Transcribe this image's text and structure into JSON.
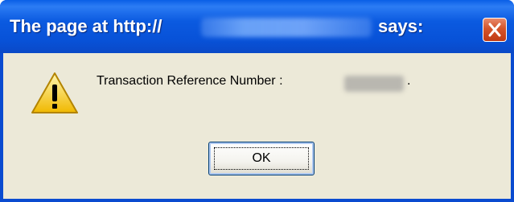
{
  "dialog": {
    "title_prefix": "The page at http://",
    "title_url": "",
    "title_suffix": "says:",
    "close_icon": "close-icon",
    "message_label": "Transaction Reference Number :",
    "message_value": "",
    "message_end": ".",
    "icon": "warning-icon",
    "ok_label": "OK"
  },
  "colors": {
    "titlebar": "#0a5fe6",
    "client": "#ece9d8",
    "close": "#d4542a",
    "warning": "#f5c518"
  }
}
